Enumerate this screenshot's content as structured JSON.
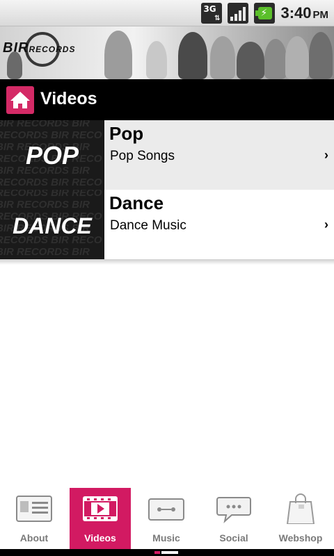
{
  "status_bar": {
    "network_label": "3G",
    "time": "3:40",
    "ampm": "PM",
    "icons": [
      "network-3g-icon",
      "signal-strength-icon",
      "battery-charging-icon"
    ]
  },
  "banner": {
    "logo_text": "BIR RECORDS"
  },
  "header": {
    "title": "Videos",
    "home_icon": "home-icon",
    "accent_color": "#d42a66"
  },
  "list": {
    "items": [
      {
        "thumb_text": "POP",
        "title": "Pop",
        "subtitle": "Pop Songs",
        "chevron": "›"
      },
      {
        "thumb_text": "DANCE",
        "title": "Dance",
        "subtitle": "Dance Music",
        "chevron": "›"
      }
    ]
  },
  "tabs": [
    {
      "label": "About",
      "icon": "contact-card-icon",
      "active": false
    },
    {
      "label": "Videos",
      "icon": "film-play-icon",
      "active": true
    },
    {
      "label": "Music",
      "icon": "cassette-icon",
      "active": false
    },
    {
      "label": "Social",
      "icon": "speech-bubble-icon",
      "active": false
    },
    {
      "label": "Webshop",
      "icon": "shopping-bag-icon",
      "active": false
    }
  ],
  "pager": {
    "current_page": 1,
    "total_pages": 2
  },
  "colors": {
    "tab_active": "#d21a62",
    "titlebar": "#000000"
  }
}
